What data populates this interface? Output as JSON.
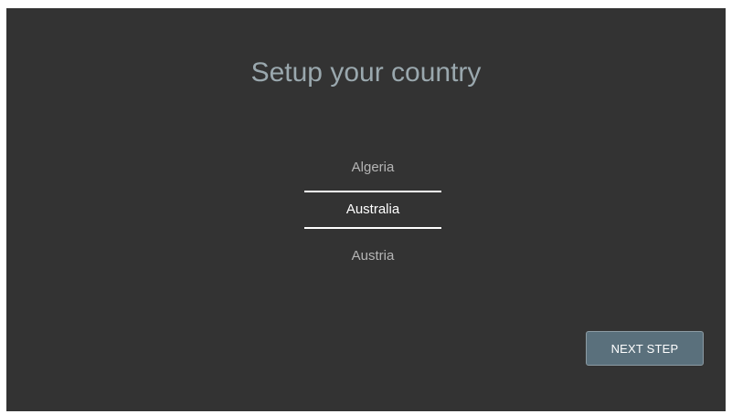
{
  "title": "Setup your country",
  "country_picker": {
    "options": [
      "Algeria",
      "Australia",
      "Austria"
    ],
    "selected_index": 1
  },
  "next_button": {
    "label": "NEXT STEP"
  },
  "colors": {
    "background": "#333333",
    "title": "#9aa8ae",
    "option_text": "#b5b5b5",
    "selected_text": "#ffffff",
    "button_bg": "#5a707c"
  }
}
